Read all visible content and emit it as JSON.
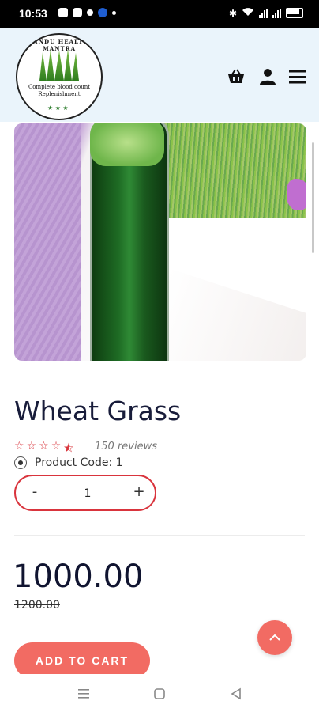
{
  "status_bar": {
    "time": "10:53",
    "icons": [
      "snapchat-icon",
      "messages-icon",
      "dot-icon",
      "facebook-icon",
      "dot-icon",
      "bluetooth-icon",
      "wifi-icon",
      "signal-icon",
      "signal-icon",
      "battery-icon"
    ]
  },
  "header": {
    "logo": {
      "top_text": "HINDU HEALTH MANTRA",
      "banner_line1": "Complete blood count",
      "banner_line2": "Replenishment"
    },
    "icons": [
      "basket-icon",
      "user-icon",
      "menu-icon"
    ]
  },
  "product": {
    "image_alt": "Wheat grass juice glass beside wheatgrass tray",
    "name": "Wheat Grass",
    "rating": 4.5,
    "reviews": "150 reviews",
    "code_label": "Product Code: 1",
    "quantity": "1",
    "minus": "-",
    "plus": "+",
    "price": "1000.00",
    "old_price": "1200.00",
    "add_to_cart": "ADD TO CART"
  },
  "colors": {
    "accent": "#f26b63",
    "quantity_border": "#d9343d",
    "header_bg": "#eaf4fb",
    "title": "#181c3a"
  },
  "nav_bar": {
    "icons": [
      "recent-apps-icon",
      "home-icon",
      "back-icon"
    ]
  }
}
